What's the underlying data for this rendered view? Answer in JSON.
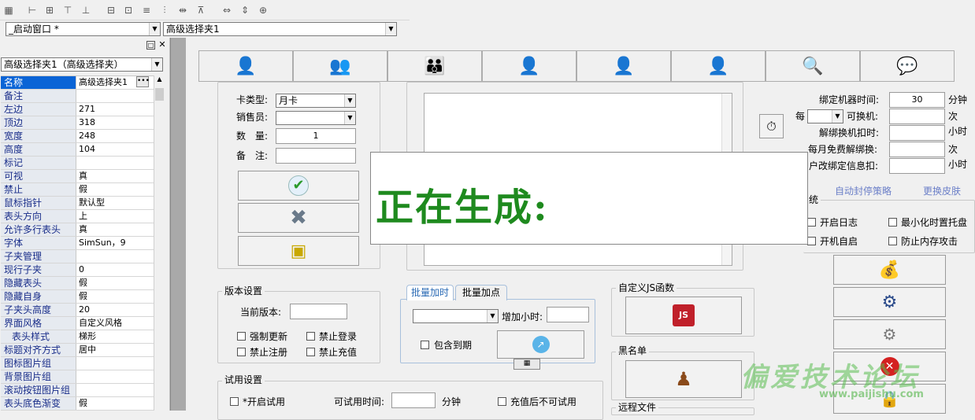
{
  "toolbar": {
    "icons": [
      "grid-icon",
      "align-left-icon",
      "align-center-icon",
      "align-top-icon",
      "align-bottom-icon",
      "same-width-icon",
      "same-height-icon",
      "same-size-icon",
      "h-space-icon",
      "v-space-icon",
      "h-center-icon",
      "v-center-icon",
      "center-icon"
    ]
  },
  "window_select": {
    "value": "_启动窗口 *"
  },
  "control_select": {
    "value": "高级选择夹1"
  },
  "prop_panel": {
    "object_select": "高级选择夹1（高级选择夹）",
    "rows": [
      {
        "k": "名称",
        "v": "高级选择夹1"
      },
      {
        "k": "备注",
        "v": ""
      },
      {
        "k": "左边",
        "v": "271"
      },
      {
        "k": "顶边",
        "v": "318"
      },
      {
        "k": "宽度",
        "v": "248"
      },
      {
        "k": "高度",
        "v": "104"
      },
      {
        "k": "标记",
        "v": ""
      },
      {
        "k": "可视",
        "v": "真"
      },
      {
        "k": "禁止",
        "v": "假"
      },
      {
        "k": "鼠标指针",
        "v": "默认型"
      },
      {
        "k": "表头方向",
        "v": "上"
      },
      {
        "k": "允许多行表头",
        "v": "真"
      },
      {
        "k": "字体",
        "v": "SimSun，9"
      },
      {
        "k": "子夹管理",
        "v": ""
      },
      {
        "k": "现行子夹",
        "v": "0"
      },
      {
        "k": "隐藏表头",
        "v": "假"
      },
      {
        "k": "隐藏自身",
        "v": "假"
      },
      {
        "k": "子夹头高度",
        "v": "20"
      },
      {
        "k": "界面风格",
        "v": "自定义风格"
      },
      {
        "k": "表头样式",
        "v": "梯形"
      },
      {
        "k": "标题对齐方式",
        "v": "居中"
      },
      {
        "k": "图标图片组",
        "v": ""
      },
      {
        "k": "背景图片组",
        "v": ""
      },
      {
        "k": "滚动按钮图片组",
        "v": ""
      },
      {
        "k": "表头底色渐变",
        "v": "假"
      }
    ]
  },
  "top_buttons": [
    {
      "name": "user-key-icon",
      "glyph": "👤"
    },
    {
      "name": "users-icon",
      "glyph": "👥"
    },
    {
      "name": "group-icon",
      "glyph": "👪"
    },
    {
      "name": "user-check-icon",
      "glyph": "👤"
    },
    {
      "name": "user-add-icon",
      "glyph": "👤"
    },
    {
      "name": "user-delete-icon",
      "glyph": "👤"
    },
    {
      "name": "search-icon",
      "glyph": "🔍"
    },
    {
      "name": "chat-icon",
      "glyph": "💬"
    }
  ],
  "card": {
    "type_label": "卡类型:",
    "type_value": "月卡",
    "seller_label": "销售员:",
    "qty_label": "数　量:",
    "qty_value": "1",
    "note_label": "备　注:"
  },
  "overlay": {
    "text": "正在生成:"
  },
  "bind": {
    "bind_time_label": "绑定机器时间:",
    "bind_time_value": "30",
    "bind_time_unit": "分钟",
    "per_label": "每",
    "changeable_label": "可换机:",
    "changeable_unit": "次",
    "unbind_label": "解绑换机扣时:",
    "unbind_unit": "小时",
    "free_unbind_label": "每月免费解绑换:",
    "free_unbind_unit": "次",
    "modify_label": "户改绑定信息扣:",
    "modify_unit": "小时"
  },
  "links": {
    "auto_block": "自动封停策略",
    "change_skin": "更换皮肤"
  },
  "system": {
    "title": "统",
    "log": "开启日志",
    "minimize_tray": "最小化时置托盘",
    "autostart": "开机自启",
    "anti_mem": "防止内存攻击"
  },
  "version": {
    "title": "版本设置",
    "current_label": "当前版本:",
    "force_update": "强制更新",
    "forbid_login": "禁止登录",
    "forbid_register": "禁止注册",
    "forbid_recharge": "禁止充值"
  },
  "batch": {
    "tab1": "批量加时",
    "tab2": "批量加点",
    "add_hours": "增加小时:",
    "include_expired": "包含到期"
  },
  "custom_js": {
    "title": "自定义JS函数",
    "icon": "JS"
  },
  "blacklist": {
    "title": "黑名单"
  },
  "remote": {
    "title": "远程文件"
  },
  "trial": {
    "title": "试用设置",
    "enable": "*开启试用",
    "time_label": "可试用时间:",
    "time_unit": "分钟",
    "no_trial_after": "充值后不可试用"
  },
  "watermark": {
    "main": "偏爱技术论坛",
    "url": "www.paijishu.com"
  }
}
